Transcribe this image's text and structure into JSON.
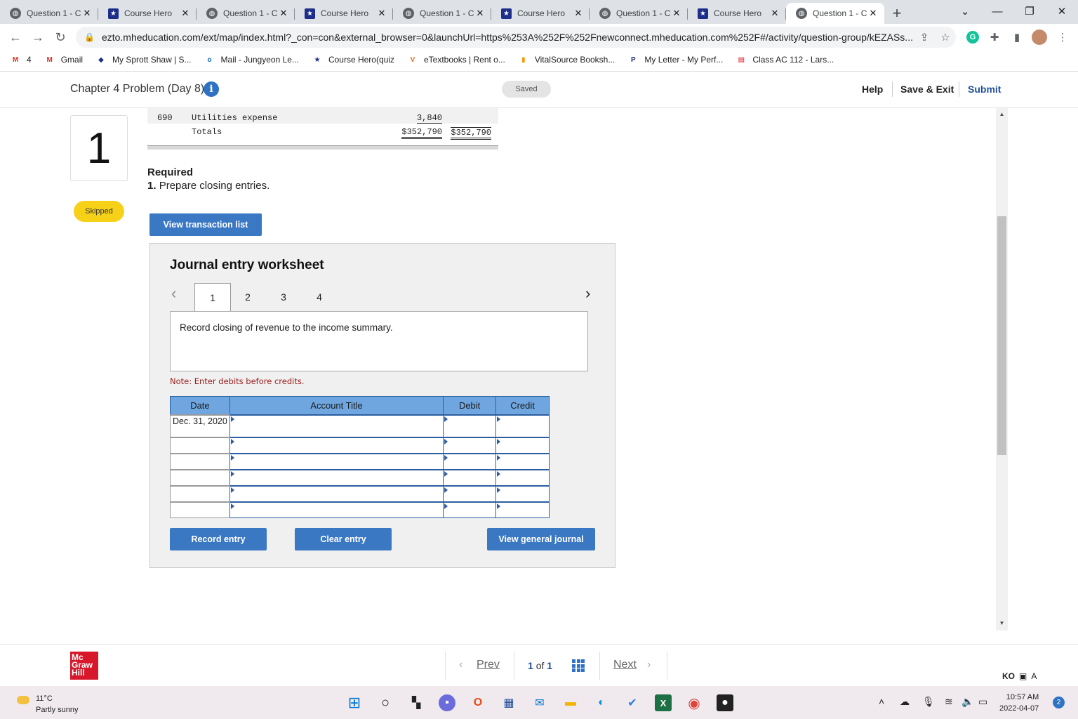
{
  "browser": {
    "tabs": [
      {
        "label": "Question 1 - C",
        "type": "globe"
      },
      {
        "label": "Course Hero",
        "type": "star"
      },
      {
        "label": "Question 1 - C",
        "type": "globe"
      },
      {
        "label": "Course Hero",
        "type": "star"
      },
      {
        "label": "Question 1 - C",
        "type": "globe"
      },
      {
        "label": "Course Hero",
        "type": "star"
      },
      {
        "label": "Question 1 - C",
        "type": "globe"
      },
      {
        "label": "Course Hero",
        "type": "star"
      },
      {
        "label": "Question 1 - C",
        "type": "globe",
        "active": true
      }
    ],
    "new_tab": "+",
    "url": "ezto.mheducation.com/ext/map/index.html?_con=con&external_browser=0&launchUrl=https%253A%252F%252Fnewconnect.mheducation.com%252F#/activity/question-group/kEZASs...",
    "bookmarks": [
      {
        "label": "4",
        "icon": "M",
        "color": "#d93025"
      },
      {
        "label": "Gmail",
        "icon": "M",
        "color": "#d93025"
      },
      {
        "label": "My Sprott Shaw | S...",
        "icon": "◆",
        "color": "#1c2d8a"
      },
      {
        "label": "Mail - Jungyeon Le...",
        "icon": "o",
        "color": "#0a64c8"
      },
      {
        "label": "Course Hero(quiz",
        "icon": "★",
        "color": "#1c2d8a"
      },
      {
        "label": "eTextbooks | Rent o...",
        "icon": "V",
        "color": "#f26b1d"
      },
      {
        "label": "VitalSource Booksh...",
        "icon": "▮",
        "color": "#f39c12"
      },
      {
        "label": "My Letter - My Perf...",
        "icon": "P",
        "color": "#1c2d8a"
      },
      {
        "label": "Class AC 112 - Lars...",
        "icon": "▤",
        "color": "#d7182a"
      }
    ]
  },
  "header": {
    "title": "Chapter 4 Problem (Day 8)",
    "saved": "Saved",
    "help": "Help",
    "save_exit": "Save & Exit",
    "submit": "Submit"
  },
  "question": {
    "number": "1",
    "status": "Skipped"
  },
  "trial_balance_fragment": {
    "rows": [
      {
        "no": "690",
        "account": "Utilities expense",
        "debit": "3,840",
        "credit": ""
      },
      {
        "no": "",
        "account": "Totals",
        "debit": "$352,790",
        "credit": "$352,790"
      }
    ]
  },
  "required": {
    "heading": "Required",
    "item_num": "1.",
    "item_text": "Prepare closing entries."
  },
  "buttons": {
    "view_transactions": "View transaction list",
    "record_entry": "Record entry",
    "clear_entry": "Clear entry",
    "view_journal": "View general journal"
  },
  "worksheet": {
    "title": "Journal entry worksheet",
    "tabs": [
      "1",
      "2",
      "3",
      "4"
    ],
    "active_tab": "1",
    "description": "Record closing of revenue to the income summary.",
    "note": "Note: Enter debits before credits.",
    "columns": [
      "Date",
      "Account Title",
      "Debit",
      "Credit"
    ],
    "rows": [
      {
        "date": "Dec. 31, 2020"
      },
      {
        "date": ""
      },
      {
        "date": ""
      },
      {
        "date": ""
      },
      {
        "date": ""
      },
      {
        "date": ""
      }
    ]
  },
  "footer": {
    "prev": "Prev",
    "page_current": "1",
    "page_of": "of",
    "page_total": "1",
    "next": "Next",
    "logo_text": "Mc Graw Hill"
  },
  "taskbar": {
    "temperature": "11°C",
    "weather": "Partly sunny",
    "time": "10:57 AM",
    "date": "2022-04-07",
    "notifications": "2",
    "ime": "KO"
  }
}
